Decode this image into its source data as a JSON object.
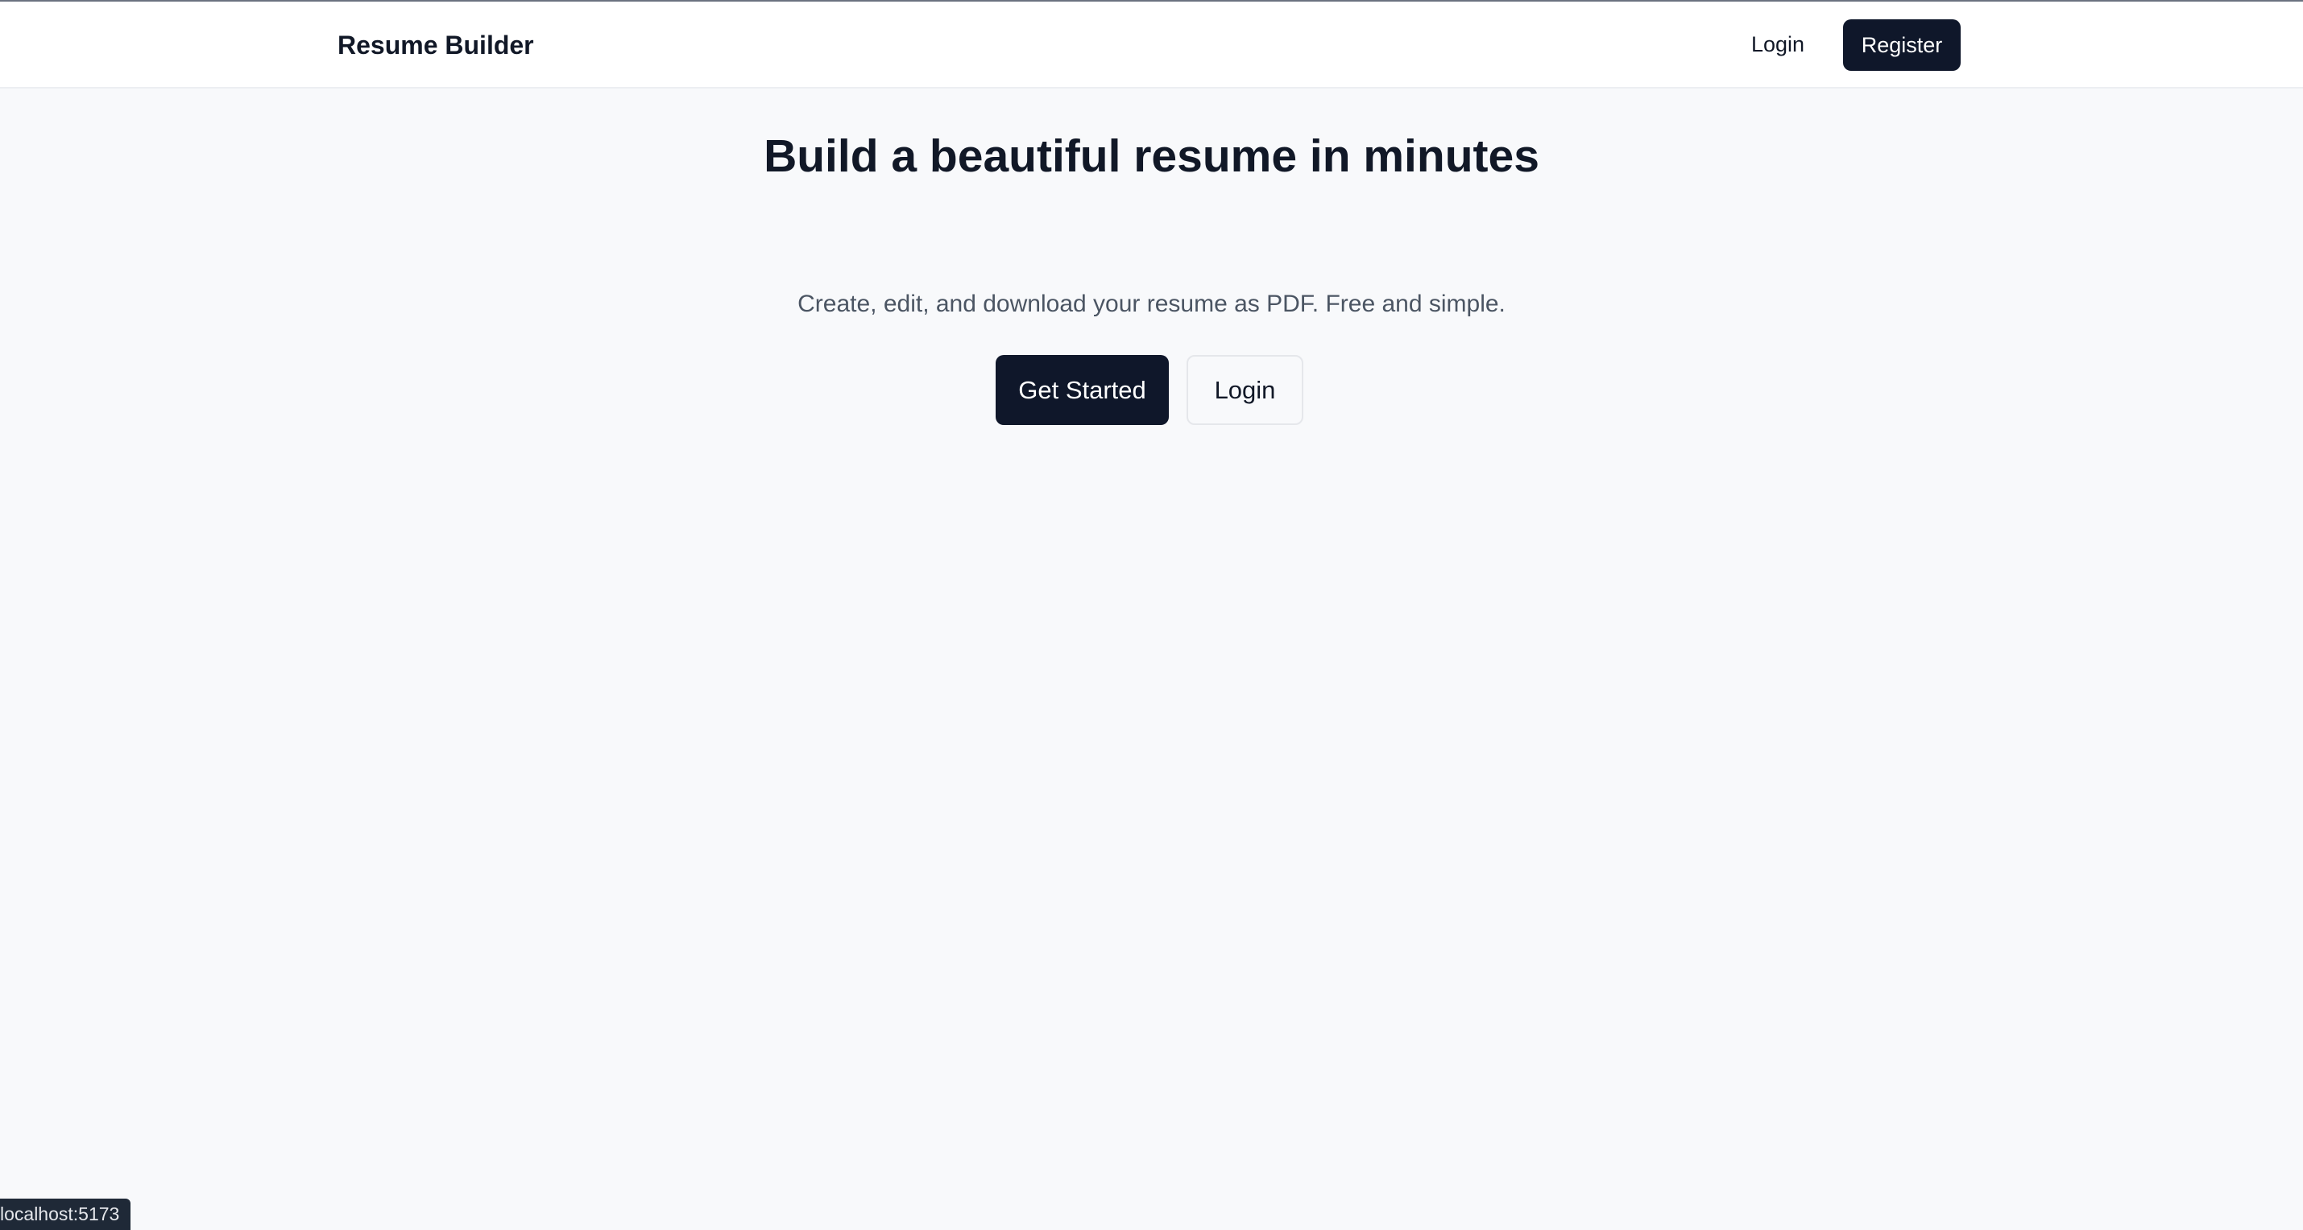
{
  "navbar": {
    "brand": "Resume Builder",
    "login_label": "Login",
    "register_label": "Register"
  },
  "hero": {
    "title": "Build a beautiful resume in minutes",
    "subtitle": "Create, edit, and download your resume as PDF. Free and simple.",
    "primary_label": "Get Started",
    "secondary_label": "Login"
  },
  "status_bar": {
    "url": "localhost:5173"
  },
  "colors": {
    "primary": "#0f172a",
    "background": "#f8f9fb",
    "text": "#111827",
    "muted": "#4b5563"
  }
}
